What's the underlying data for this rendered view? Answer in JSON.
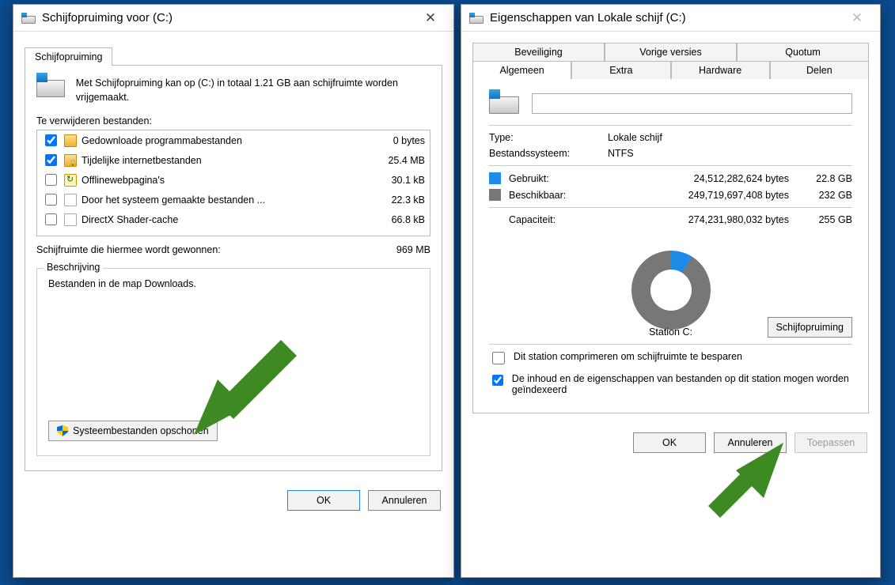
{
  "cleanup": {
    "title": "Schijfopruiming voor  (C:)",
    "tab_label": "Schijfopruiming",
    "intro": "Met Schijfopruiming kan op  (C:) in totaal 1.21 GB aan schijfruimte worden vrijgemaakt.",
    "files_label": "Te verwijderen bestanden:",
    "items": [
      {
        "checked": true,
        "icon": "folder",
        "name": "Gedownloade programmabestanden",
        "size": "0 bytes"
      },
      {
        "checked": true,
        "icon": "folderlock",
        "name": "Tijdelijke internetbestanden",
        "size": "25.4 MB"
      },
      {
        "checked": false,
        "icon": "offline",
        "name": "Offlinewebpagina's",
        "size": "30.1 kB"
      },
      {
        "checked": false,
        "icon": "page",
        "name": "Door het systeem gemaakte bestanden ...",
        "size": "22.3 kB"
      },
      {
        "checked": false,
        "icon": "page",
        "name": "DirectX Shader-cache",
        "size": "66.8 kB"
      }
    ],
    "gain_label": "Schijfruimte die hiermee wordt gewonnen:",
    "gain_value": "969 MB",
    "desc_legend": "Beschrijving",
    "desc_text": "Bestanden in de map Downloads.",
    "sysclean": "Systeembestanden opschonen",
    "ok": "OK",
    "cancel": "Annuleren"
  },
  "props": {
    "title": "Eigenschappen van Lokale schijf (C:)",
    "tabs_top": [
      "Beveiliging",
      "Vorige versies",
      "Quotum"
    ],
    "tabs_bottom": [
      "Algemeen",
      "Extra",
      "Hardware",
      "Delen"
    ],
    "active_tab": "Algemeen",
    "type_label": "Type:",
    "type_value": "Lokale schijf",
    "fs_label": "Bestandssysteem:",
    "fs_value": "NTFS",
    "used_label": "Gebruikt:",
    "used_bytes": "24,512,282,624 bytes",
    "used_gb": "22.8 GB",
    "free_label": "Beschikbaar:",
    "free_bytes": "249,719,697,408 bytes",
    "free_gb": "232 GB",
    "cap_label": "Capaciteit:",
    "cap_bytes": "274,231,980,032 bytes",
    "cap_gb": "255 GB",
    "station_label": "Station C:",
    "cleanup_btn": "Schijfopruiming",
    "compress": "Dit station comprimeren om schijfruimte te besparen",
    "index": "De inhoud en de eigenschappen van bestanden op dit station mogen worden geïndexeerd",
    "ok": "OK",
    "cancel": "Annuleren",
    "apply": "Toepassen",
    "volume_name": ""
  }
}
